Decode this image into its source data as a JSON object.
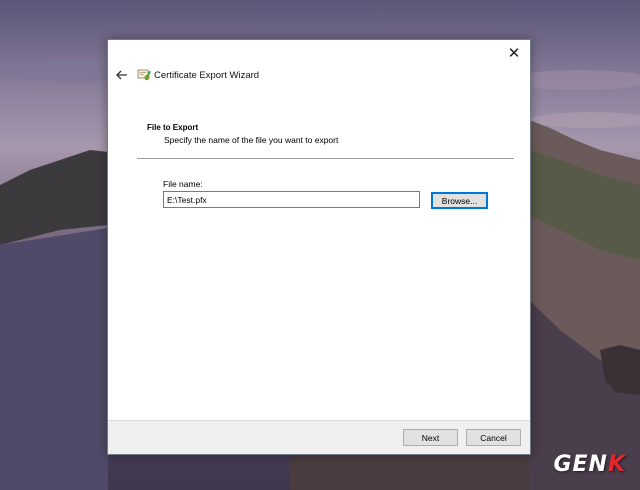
{
  "window": {
    "title": "Certificate Export Wizard",
    "close_glyph": "✕"
  },
  "page": {
    "section_title": "File to Export",
    "section_subtitle": "Specify the name of the file you want to export"
  },
  "file": {
    "label": "File name:",
    "value": "E:\\Test.pfx",
    "browse_label": "Browse..."
  },
  "footer": {
    "next_label": "Next",
    "cancel_label": "Cancel"
  },
  "watermark": {
    "text_main": "GEN",
    "text_accent": "K"
  },
  "icons": {
    "back": "back-arrow-icon",
    "wizard": "certificate-icon",
    "close": "close-icon"
  },
  "colors": {
    "focus_accent": "#0078d7",
    "footer_bg": "#f0f0f0",
    "watermark_accent": "#e5262a"
  }
}
